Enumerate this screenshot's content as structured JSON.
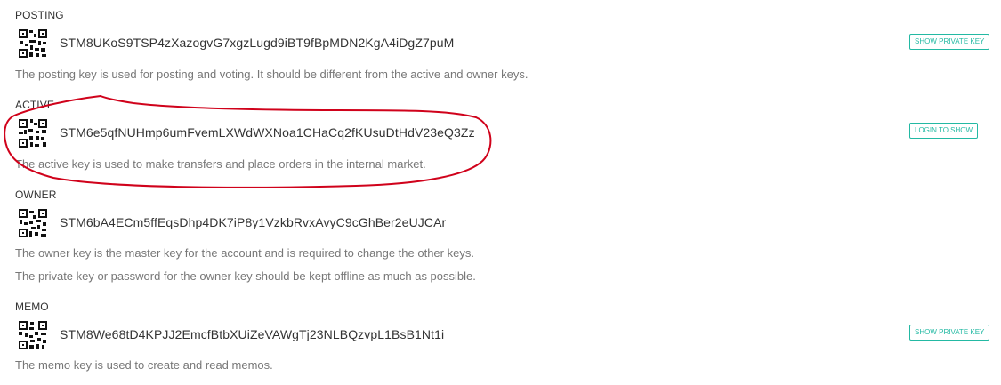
{
  "sections": [
    {
      "label": "POSTING",
      "key": "STM8UKoS9TSP4zXazogvG7xgzLugd9iBT9fBpMDN2KgA4iDgZ7puM",
      "descriptions": [
        "The posting key is used for posting and voting. It should be different from the active and owner keys."
      ],
      "button": "SHOW PRIVATE KEY"
    },
    {
      "label": "ACTIVE",
      "key": "STM6e5qfNUHmp6umFvemLXWdWXNoa1CHaCq2fKUsuDtHdV23eQ3Zz",
      "descriptions": [
        "The active key is used to make transfers and place orders in the internal market."
      ],
      "button": "LOGIN TO SHOW"
    },
    {
      "label": "OWNER",
      "key": "STM6bA4ECm5ffEqsDhp4DK7iP8y1VzkbRvxAvyC9cGhBer2eUJCAr",
      "descriptions": [
        "The owner key is the master key for the account and is required to change the other keys.",
        "The private key or password for the owner key should be kept offline as much as possible."
      ]
    },
    {
      "label": "MEMO",
      "key": "STM8We68tD4KPJJ2EmcfBtbXUiZeVAWgTj23NLBQzvpL1BsB1Nt1i",
      "descriptions": [
        "The memo key is used to create and read memos."
      ],
      "button": "SHOW PRIVATE KEY"
    }
  ],
  "colors": {
    "accent": "#23b9a3",
    "annotation": "#d0021b",
    "text": "#333333",
    "muted": "#777777"
  },
  "icons": {
    "qr": "qr-code-icon"
  }
}
